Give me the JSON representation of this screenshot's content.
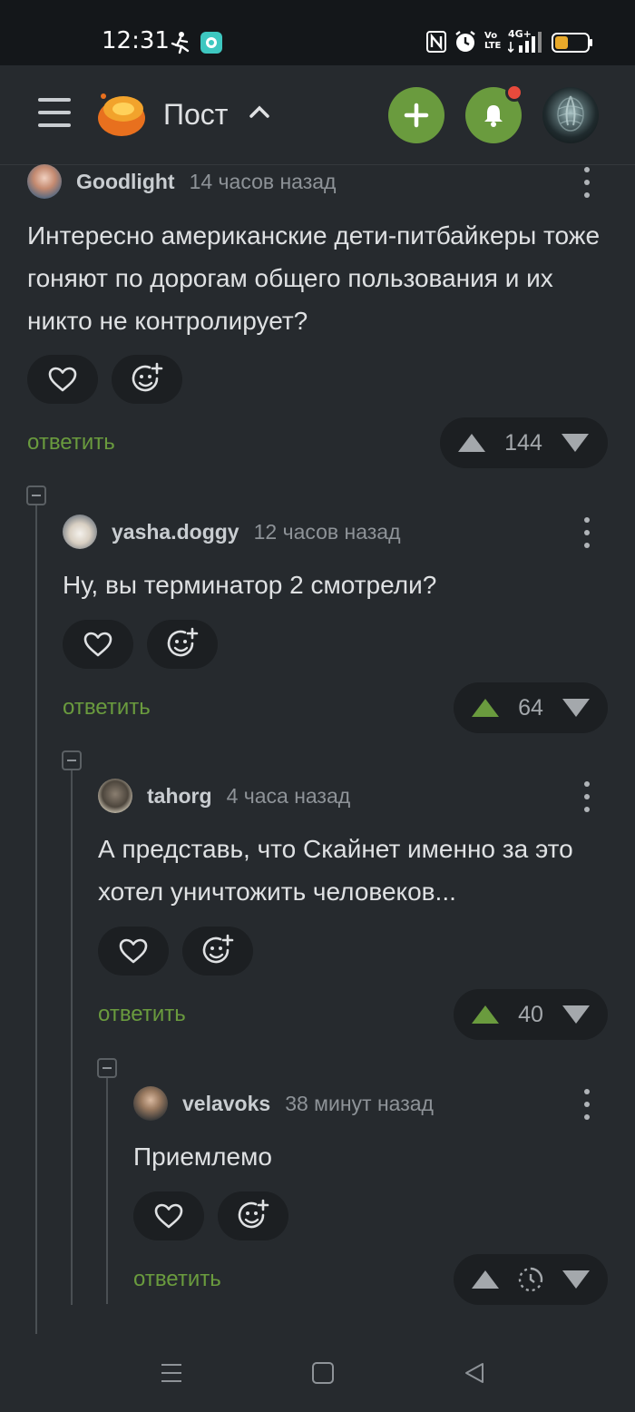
{
  "status_bar": {
    "time": "12:31",
    "network": "4G+",
    "volte": "Vo LTE"
  },
  "header": {
    "title": "Пост"
  },
  "comments": [
    {
      "user": "Goodlight",
      "time": "14 часов назад",
      "text": "Интересно американские дети-питбайкеры тоже гоняют по дорогам общего пользования и их никто не контролирует?",
      "reply_label": "ответить",
      "score": "144",
      "upvoted": false
    },
    {
      "user": "yasha.doggy",
      "time": "12 часов назад",
      "text": "Ну, вы терминатор 2 смотрели?",
      "reply_label": "ответить",
      "score": "64",
      "upvoted": true
    },
    {
      "user": "tahorg",
      "time": "4 часа назад",
      "text": "А представь, что Скайнет именно за это хотел уничтожить человеков...",
      "reply_label": "ответить",
      "score": "40",
      "upvoted": true
    },
    {
      "user": "velavoks",
      "time": "38 минут назад",
      "text": "Приемлемо",
      "reply_label": "ответить",
      "score_state": "pending-clock-icon",
      "upvoted": false
    }
  ],
  "colors": {
    "accent": "#6a9b3e",
    "background": "#262a2e",
    "pill": "#1c1f22",
    "notification": "#e84a3c"
  }
}
